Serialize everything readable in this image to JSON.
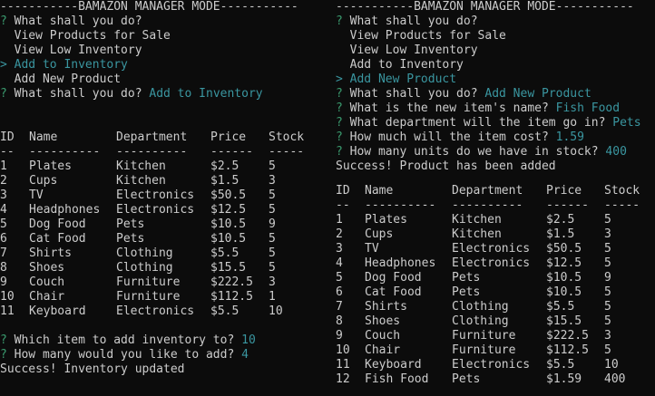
{
  "left": {
    "banner": "-----------BAMAZON MANAGER MODE-----------",
    "menu_question": "What shall you do?",
    "menu_options": [
      "View Products for Sale",
      "View Low Inventory",
      "Add to Inventory",
      "Add New Product"
    ],
    "selected_marker": ">",
    "selected_option": "Add to Inventory",
    "answer_question": "What shall you do?",
    "answer": "Add to Inventory",
    "table": {
      "headers": [
        "ID",
        "Name",
        "Department",
        "Price",
        "Stock"
      ],
      "dividers": [
        "--",
        "----------",
        "----------",
        "------",
        "-----"
      ],
      "rows": [
        [
          "1",
          "Plates",
          "Kitchen",
          "$2.5",
          "5"
        ],
        [
          "2",
          "Cups",
          "Kitchen",
          "$1.5",
          "3"
        ],
        [
          "3",
          "TV",
          "Electronics",
          "$50.5",
          "5"
        ],
        [
          "4",
          "Headphones",
          "Electronics",
          "$12.5",
          "5"
        ],
        [
          "5",
          "Dog Food",
          "Pets",
          "$10.5",
          "9"
        ],
        [
          "6",
          "Cat Food",
          "Pets",
          "$10.5",
          "5"
        ],
        [
          "7",
          "Shirts",
          "Clothing",
          "$5.5",
          "5"
        ],
        [
          "8",
          "Shoes",
          "Clothing",
          "$15.5",
          "5"
        ],
        [
          "9",
          "Couch",
          "Furniture",
          "$222.5",
          "3"
        ],
        [
          "10",
          "Chair",
          "Furniture",
          "$112.5",
          "1"
        ],
        [
          "11",
          "Keyboard",
          "Electronics",
          "$5.5",
          "10"
        ]
      ]
    },
    "prompts": [
      {
        "question": "Which item to add inventory to?",
        "answer": "10"
      },
      {
        "question": "How many would you like to add?",
        "answer": "4"
      }
    ],
    "result": "Success! Inventory updated"
  },
  "right": {
    "banner": "-----------BAMAZON MANAGER MODE-----------",
    "menu_question": "What shall you do?",
    "menu_options": [
      "View Products for Sale",
      "View Low Inventory",
      "Add to Inventory",
      "Add New Product"
    ],
    "selected_marker": ">",
    "selected_option": "Add New Product",
    "answer_question": "What shall you do?",
    "answer": "Add New Product",
    "prompts": [
      {
        "question": "What is the new item's name?",
        "answer": "Fish Food"
      },
      {
        "question": "What department will the item go in?",
        "answer": "Pets"
      },
      {
        "question": "How much will the item cost?",
        "answer": "1.59"
      },
      {
        "question": "How many units do we have in stock?",
        "answer": "400"
      }
    ],
    "result": "Success! Product has been added",
    "table": {
      "headers": [
        "ID",
        "Name",
        "Department",
        "Price",
        "Stock"
      ],
      "dividers": [
        "--",
        "----------",
        "----------",
        "------",
        "-----"
      ],
      "rows": [
        [
          "1",
          "Plates",
          "Kitchen",
          "$2.5",
          "5"
        ],
        [
          "2",
          "Cups",
          "Kitchen",
          "$1.5",
          "3"
        ],
        [
          "3",
          "TV",
          "Electronics",
          "$50.5",
          "5"
        ],
        [
          "4",
          "Headphones",
          "Electronics",
          "$12.5",
          "5"
        ],
        [
          "5",
          "Dog Food",
          "Pets",
          "$10.5",
          "9"
        ],
        [
          "6",
          "Cat Food",
          "Pets",
          "$10.5",
          "5"
        ],
        [
          "7",
          "Shirts",
          "Clothing",
          "$5.5",
          "5"
        ],
        [
          "8",
          "Shoes",
          "Clothing",
          "$15.5",
          "5"
        ],
        [
          "9",
          "Couch",
          "Furniture",
          "$222.5",
          "3"
        ],
        [
          "10",
          "Chair",
          "Furniture",
          "$112.5",
          "5"
        ],
        [
          "11",
          "Keyboard",
          "Electronics",
          "$5.5",
          "10"
        ],
        [
          "12",
          "Fish Food",
          "Pets",
          "$1.59",
          "400"
        ]
      ]
    }
  },
  "symbols": {
    "prompt_mark": "?"
  },
  "colors": {
    "background": "#0c0c0c",
    "text": "#cccccc",
    "prompt_mark": "#3a9a6e",
    "answer": "#3a96a0"
  }
}
